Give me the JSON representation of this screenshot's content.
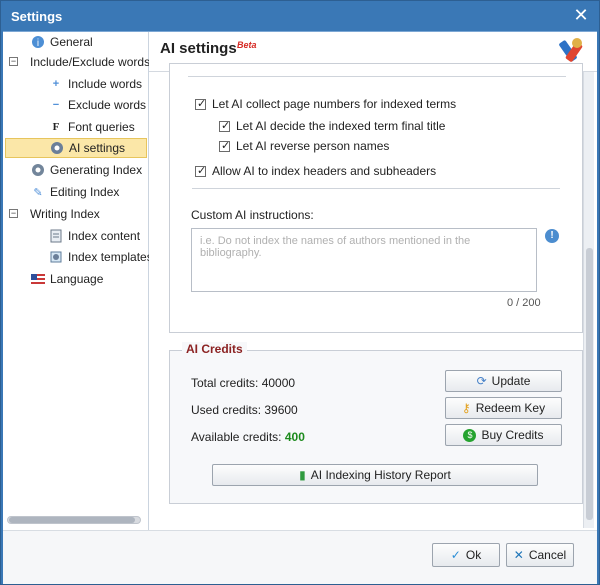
{
  "window": {
    "title": "Settings",
    "close_symbol": "✕"
  },
  "sidebar": {
    "items": [
      {
        "label": "General"
      },
      {
        "label": "Include/Exclude words"
      },
      {
        "label": "Include words"
      },
      {
        "label": "Exclude words"
      },
      {
        "label": "Font queries"
      },
      {
        "label": "AI settings"
      },
      {
        "label": "Generating Index"
      },
      {
        "label": "Editing Index"
      },
      {
        "label": "Writing Index"
      },
      {
        "label": "Index content"
      },
      {
        "label": "Index templates"
      },
      {
        "label": "Language"
      }
    ]
  },
  "header": {
    "title": "AI settings",
    "badge": "Beta"
  },
  "options": {
    "collect_pages": "Let AI collect page numbers for indexed terms",
    "final_title": "Let AI decide the indexed term final title",
    "reverse_names": "Let AI reverse person names",
    "headers": "Allow AI to index headers and subheaders"
  },
  "custom": {
    "label": "Custom AI instructions:",
    "placeholder": "i.e. Do not index the names of authors mentioned in the bibliography.",
    "counter": "0 / 200"
  },
  "credits": {
    "title": "AI Credits",
    "total": "Total credits: 40000",
    "used": "Used credits: 39600",
    "available_label": "Available credits:",
    "available_value": "400",
    "buttons": {
      "update": "Update",
      "redeem": "Redeem Key",
      "buy": "Buy Credits",
      "history": "AI Indexing History Report"
    }
  },
  "footer": {
    "ok": "Ok",
    "cancel": "Cancel"
  },
  "colors": {
    "title_blue": "#3a78b6",
    "credits_green": "#1d8b1d",
    "accent_red": "#d62a24"
  }
}
